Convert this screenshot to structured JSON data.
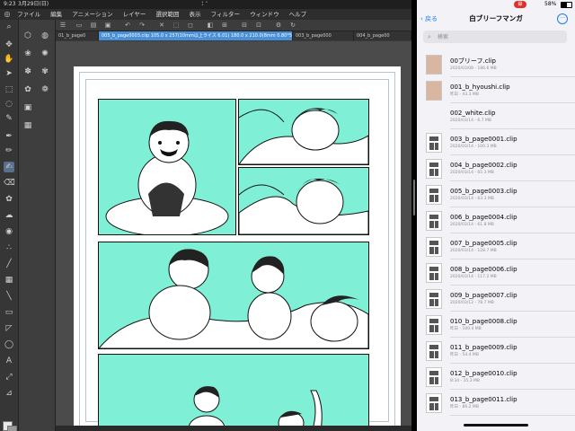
{
  "left_app": {
    "status": {
      "time": "9:23",
      "date": "3月29日(日)"
    },
    "menu": [
      "ファイル",
      "編集",
      "アニメーション",
      "レイヤー",
      "選択範囲",
      "表示",
      "フィルター",
      "ウィンドウ",
      "ヘルプ"
    ],
    "tabs": [
      {
        "label": "01_b_page0"
      },
      {
        "label": "005_b_page0003.clip 105.0 x 257(10mm以上ライス 6.01) 180.0 x 210.0(8mm 0.80*50)"
      },
      {
        "label": "003_b_page000"
      },
      {
        "label": "004_b_page00"
      }
    ],
    "panel_color": "#7ff0d6"
  },
  "right_app": {
    "status": {
      "rec": "録",
      "battery": "58%"
    },
    "nav": {
      "back_label": "戻る",
      "title": "白ブリーフマンガ",
      "more_icon": "ellipsis-icon"
    },
    "search": {
      "placeholder": "検索"
    },
    "files": [
      {
        "name": "00ブリーフ.clip",
        "meta": "2020/03/08 - 186.6 MB",
        "thumb": "cover"
      },
      {
        "name": "001_b_hyoushi.clip",
        "meta": "昨日 - 43.3 MB",
        "thumb": "cover"
      },
      {
        "name": "002_white.clip",
        "meta": "2020/03/14 - 6.7 MB",
        "thumb": "blank"
      },
      {
        "name": "003_b_page0001.clip",
        "meta": "2020/03/14 - 100.3 MB",
        "thumb": "page"
      },
      {
        "name": "004_b_page0002.clip",
        "meta": "2020/03/14 - 65.3 MB",
        "thumb": "page"
      },
      {
        "name": "005_b_page0003.clip",
        "meta": "2020/03/14 - 63.3 MB",
        "thumb": "page"
      },
      {
        "name": "006_b_page0004.clip",
        "meta": "2020/03/14 - 61.8 MB",
        "thumb": "page"
      },
      {
        "name": "007_b_page0005.clip",
        "meta": "2020/03/14 - 128.7 MB",
        "thumb": "page"
      },
      {
        "name": "008_b_page0006.clip",
        "meta": "2020/03/14 - 117.2 MB",
        "thumb": "page"
      },
      {
        "name": "009_b_page0007.clip",
        "meta": "2020/03/12 - 78.7 MB",
        "thumb": "page"
      },
      {
        "name": "010_b_page0008.clip",
        "meta": "昨日 - 100.4 MB",
        "thumb": "page"
      },
      {
        "name": "011_b_page0009.clip",
        "meta": "昨日 - 54.4 MB",
        "thumb": "page"
      },
      {
        "name": "012_b_page0010.clip",
        "meta": "8:34 - 35.3 MB",
        "thumb": "page"
      },
      {
        "name": "013_b_page0011.clip",
        "meta": "昨日 - 86.2 MB",
        "thumb": "page"
      }
    ]
  }
}
